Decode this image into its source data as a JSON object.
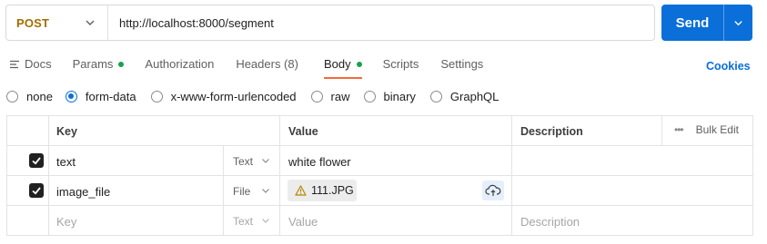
{
  "request": {
    "method": "POST",
    "url": "http://localhost:8000/segment",
    "send_label": "Send"
  },
  "tabs": [
    {
      "label": "Docs",
      "icon": "docs-icon",
      "active": false
    },
    {
      "label": "Params",
      "dot": true,
      "active": false
    },
    {
      "label": "Authorization",
      "active": false
    },
    {
      "label": "Headers (8)",
      "active": false
    },
    {
      "label": "Body",
      "dot": true,
      "active": true
    },
    {
      "label": "Scripts",
      "active": false
    },
    {
      "label": "Settings",
      "active": false
    }
  ],
  "cookies_label": "Cookies",
  "body_types": {
    "selected": "form-data",
    "options": [
      "none",
      "form-data",
      "x-www-form-urlencoded",
      "raw",
      "binary",
      "GraphQL"
    ]
  },
  "table": {
    "headers": {
      "key": "Key",
      "value": "Value",
      "description": "Description",
      "bulk_edit": "Bulk Edit"
    },
    "rows": [
      {
        "checked": true,
        "key": "text",
        "type": "Text",
        "value": "white flower",
        "description": ""
      },
      {
        "checked": true,
        "key": "image_file",
        "type": "File",
        "file_name": "111.JPG",
        "description": ""
      }
    ],
    "placeholder": {
      "key": "Key",
      "type": "Text",
      "value": "Value",
      "description": "Description"
    }
  },
  "colors": {
    "accent_blue": "#0a6fd8",
    "method_color": "#a36d00",
    "active_tab_underline": "#f26b3a",
    "status_dot": "#16a34a",
    "warning": "#b38600"
  }
}
